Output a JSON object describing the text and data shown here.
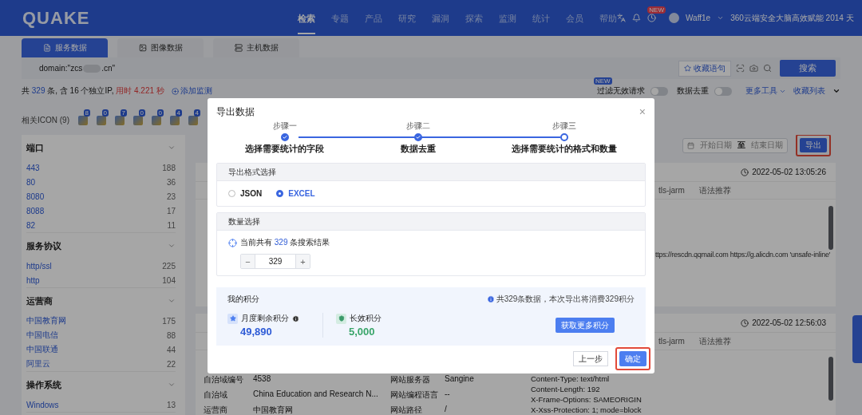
{
  "nav": {
    "logo": "QUAKE",
    "items": [
      {
        "label": "检索",
        "selected": true
      },
      {
        "label": "专题",
        "selected": false
      },
      {
        "label": "产品",
        "selected": false
      },
      {
        "label": "研究",
        "selected": false
      },
      {
        "label": "漏洞",
        "selected": false
      },
      {
        "label": "探索",
        "selected": false
      },
      {
        "label": "监测",
        "selected": false
      },
      {
        "label": "统计",
        "selected": false
      },
      {
        "label": "会员",
        "selected": false
      },
      {
        "label": "帮助",
        "selected": false
      }
    ],
    "badge": "NEW",
    "user": "Waff1e",
    "banner": "360云端安全大脑高效赋能 2014 天"
  },
  "search_tabs": [
    {
      "label": "服务数据",
      "selected": true
    },
    {
      "label": "图像数据",
      "selected": false
    },
    {
      "label": "主机数据",
      "selected": false
    }
  ],
  "query": {
    "start": "domain:\"zcs",
    "end": ".cn\"",
    "save": "收藏语句",
    "search": "搜索"
  },
  "summary": {
    "prefix": "共",
    "total": "329",
    "middle": "条, 含 16 个独立IP,",
    "time": "用时 4.221 秒",
    "monitor": "添加监测"
  },
  "filters": [
    {
      "label": "过滤无效请求",
      "badge": "NEW",
      "on": false
    },
    {
      "label": "数据去重",
      "on": false
    }
  ],
  "more_tools": "更多工具",
  "favorites": "收藏列表",
  "icons": {
    "label": "相关ICON (9)",
    "items": [
      {
        "count": "8"
      },
      {
        "count": "0"
      },
      {
        "count": "7"
      },
      {
        "count": "0"
      },
      {
        "count": "0"
      },
      {
        "count": "4"
      },
      {
        "count": "4"
      }
    ]
  },
  "sidebar": [
    {
      "title": "端口",
      "items": [
        {
          "label": "443",
          "count": "188"
        },
        {
          "label": "80",
          "count": "36"
        },
        {
          "label": "8080",
          "count": "23"
        },
        {
          "label": "8088",
          "count": "17"
        },
        {
          "label": "82",
          "count": "11"
        }
      ]
    },
    {
      "title": "服务协议",
      "items": [
        {
          "label": "http/ssl",
          "count": "225"
        },
        {
          "label": "http",
          "count": "104"
        }
      ]
    },
    {
      "title": "运营商",
      "items": [
        {
          "label": "中国教育网",
          "count": "175"
        },
        {
          "label": "中国电信",
          "count": "88"
        },
        {
          "label": "中国联通",
          "count": "44"
        },
        {
          "label": "阿里云",
          "count": "22"
        }
      ]
    },
    {
      "title": "操作系统",
      "items": [
        {
          "label": "Windows",
          "count": "13"
        }
      ]
    }
  ],
  "toolbar": {
    "start_placeholder": "开始日期",
    "separator": "至",
    "end_placeholder": "结束日期",
    "export": "导出",
    "export_highlighted": true
  },
  "results": [
    {
      "time": "2022-05-02 13:05:26",
      "tabs": [
        "tls-jarm",
        "语法推荐"
      ],
      "line": "ttps://rescdn.qqmail.com https://g.alicdn.com 'unsafe-inline'"
    },
    {
      "time": "2022-05-02 12:56:03",
      "tabs": [
        "tls-jarm",
        "语法推荐"
      ],
      "fields": [
        [
          "自治域编号",
          "4538",
          "网站服务器",
          "Sangine"
        ],
        [
          "自治域",
          "China Education and Research N...",
          "网站编程语言",
          "--"
        ],
        [
          "运营商",
          "中国教育网",
          "网站路径",
          "/"
        ]
      ],
      "headers": [
        "Content-Type: text/html",
        "Content-Length: 192",
        "X-Frame-Options: SAMEORIGIN",
        "X-Xss-Protection: 1; mode=block"
      ]
    }
  ],
  "modal": {
    "title": "导出数据",
    "close": "×",
    "steps": [
      {
        "step": "步骤一",
        "label": "选择需要统计的字段",
        "completed": true
      },
      {
        "step": "步骤二",
        "label": "数据去重",
        "completed": true
      },
      {
        "step": "步骤三",
        "label": "选择需要统计的格式和数量",
        "completed": false
      }
    ],
    "format": {
      "title": "导出格式选择",
      "options": [
        {
          "label": "JSON",
          "selected": false
        },
        {
          "label": "EXCEL",
          "selected": true
        }
      ]
    },
    "count": {
      "title": "数量选择",
      "prefix": "当前共有",
      "total": "329",
      "suffix": "条搜索结果",
      "minus": "−",
      "value": "329",
      "plus": "+"
    },
    "points": {
      "title": "我的积分",
      "note": "共329条数据，本次导出将消费329积分",
      "monthly_label": "月度剩余积分",
      "monthly_value": "49,890",
      "permanent_label": "长效积分",
      "permanent_value": "5,000",
      "more": "获取更多积分"
    },
    "back": "上一步",
    "confirm": "确定",
    "confirm_highlighted": true
  }
}
